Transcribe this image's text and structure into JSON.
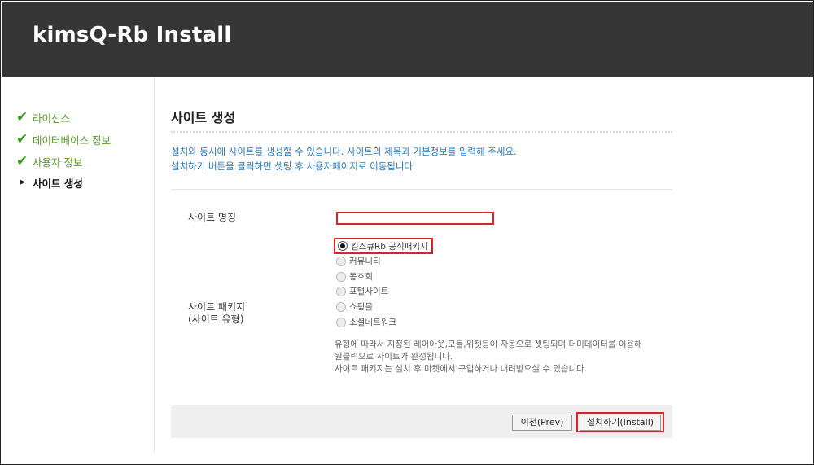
{
  "header": {
    "title": "kimsQ-Rb Install"
  },
  "steps": [
    {
      "label": "라이선스",
      "state": "done"
    },
    {
      "label": "데이터베이스 정보",
      "state": "done"
    },
    {
      "label": "사용자 정보",
      "state": "done"
    },
    {
      "label": "사이트 생성",
      "state": "current"
    }
  ],
  "main": {
    "title": "사이트 생성",
    "desc_line1": "설치와 동시에 사이트를 생성할 수 있습니다. 사이트의 제목과 기본정보를 입력해 주세요.",
    "desc_line2": "설치하기 버튼을 클릭하면 셋팅 후 사용자페이지로 이동됩니다.",
    "site_name_label": "사이트 명칭",
    "site_name_value": "",
    "package_label_line1": "사이트 패키지",
    "package_label_line2": "(사이트 유형)",
    "packages": [
      {
        "label": "킴스큐Rb 공식패키지",
        "selected": true
      },
      {
        "label": "커뮤니티",
        "selected": false
      },
      {
        "label": "동호회",
        "selected": false
      },
      {
        "label": "포털사이트",
        "selected": false
      },
      {
        "label": "쇼핑몰",
        "selected": false
      },
      {
        "label": "소셜네트워크",
        "selected": false
      }
    ],
    "note_line1": "유형에 따라서 지정된 레이아웃,모듈,위젯등이 자동으로 셋팅되며 더미데이터를 이용해",
    "note_line2": "원클릭으로 사이트가 완성됩니다.",
    "note_line3": "사이트 패키지는 설치 후 마켓에서 구입하거나 내려받으실 수 있습니다."
  },
  "buttons": {
    "prev": "이전(Prev)",
    "install": "설치하기(Install)"
  },
  "colors": {
    "header_bg": "#363636",
    "check": "#3a9a1e",
    "desc": "#2a7ab8",
    "highlight": "#dd2222"
  }
}
